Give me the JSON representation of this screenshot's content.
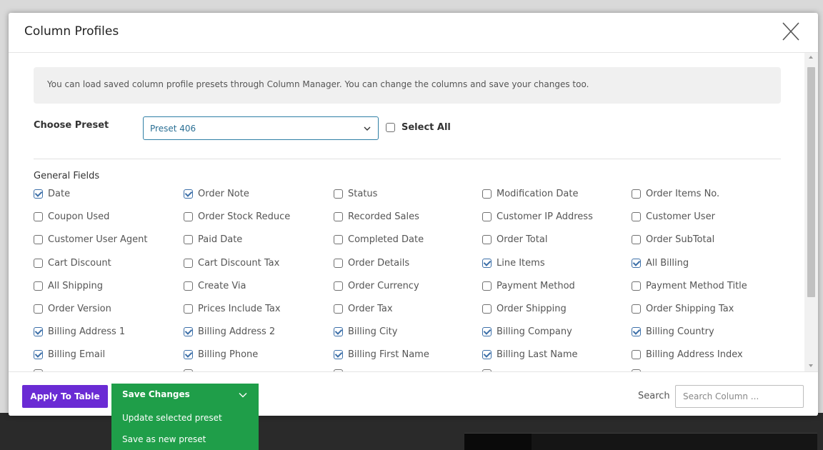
{
  "modal": {
    "title": "Column Profiles"
  },
  "info_text": "You can load saved column profile presets through Column Manager. You can change the columns and save your changes too.",
  "preset": {
    "label": "Choose Preset",
    "selected": "Preset 406"
  },
  "select_all": {
    "label": "Select All",
    "checked": false
  },
  "general_fields": {
    "title": "General Fields",
    "rows": [
      [
        {
          "label": "Date",
          "checked": true
        },
        {
          "label": "Order Note",
          "checked": true
        },
        {
          "label": "Status",
          "checked": false
        },
        {
          "label": "Modification Date",
          "checked": false
        },
        {
          "label": "Order Items No.",
          "checked": false
        }
      ],
      [
        {
          "label": "Coupon Used",
          "checked": false
        },
        {
          "label": "Order Stock Reduce",
          "checked": false
        },
        {
          "label": "Recorded Sales",
          "checked": false
        },
        {
          "label": "Customer IP Address",
          "checked": false
        },
        {
          "label": "Customer User",
          "checked": false
        }
      ],
      [
        {
          "label": "Customer User Agent",
          "checked": false
        },
        {
          "label": "Paid Date",
          "checked": false
        },
        {
          "label": "Completed Date",
          "checked": false
        },
        {
          "label": "Order Total",
          "checked": false
        },
        {
          "label": "Order SubTotal",
          "checked": false
        }
      ],
      [
        {
          "label": "Cart Discount",
          "checked": false
        },
        {
          "label": "Cart Discount Tax",
          "checked": false
        },
        {
          "label": "Order Details",
          "checked": false
        },
        {
          "label": "Line Items",
          "checked": true
        },
        {
          "label": "All Billing",
          "checked": true
        }
      ],
      [
        {
          "label": "All Shipping",
          "checked": false
        },
        {
          "label": "Create Via",
          "checked": false
        },
        {
          "label": "Order Currency",
          "checked": false
        },
        {
          "label": "Payment Method",
          "checked": false
        },
        {
          "label": "Payment Method Title",
          "checked": false
        }
      ],
      [
        {
          "label": "Order Version",
          "checked": false
        },
        {
          "label": "Prices Include Tax",
          "checked": false
        },
        {
          "label": "Order Tax",
          "checked": false
        },
        {
          "label": "Order Shipping",
          "checked": false
        },
        {
          "label": "Order Shipping Tax",
          "checked": false
        }
      ],
      [
        {
          "label": "Billing Address 1",
          "checked": true
        },
        {
          "label": "Billing Address 2",
          "checked": true
        },
        {
          "label": "Billing City",
          "checked": true
        },
        {
          "label": "Billing Company",
          "checked": true
        },
        {
          "label": "Billing Country",
          "checked": true
        }
      ],
      [
        {
          "label": "Billing Email",
          "checked": true
        },
        {
          "label": "Billing Phone",
          "checked": true
        },
        {
          "label": "Billing First Name",
          "checked": true
        },
        {
          "label": "Billing Last Name",
          "checked": true
        },
        {
          "label": "Billing Address Index",
          "checked": false
        }
      ]
    ]
  },
  "footer": {
    "apply_label": "Apply To Table",
    "save": {
      "title": "Save Changes",
      "items": [
        "Update selected preset",
        "Save as new preset"
      ],
      "color": "#1f9e49"
    },
    "search_label": "Search",
    "search_placeholder": "Search Column ..."
  },
  "colors": {
    "apply_button": "#6a2bd4",
    "preset_border": "#2f7fa5",
    "checkbox_checked": "#3c6fa8"
  }
}
